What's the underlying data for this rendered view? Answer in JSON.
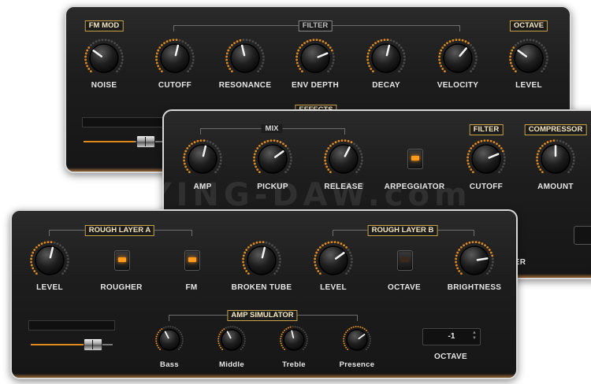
{
  "panel_top": {
    "tags": {
      "fm_mod": "FM MOD",
      "filter": "FILTER",
      "octave": "OCTAVE",
      "effects": "EFFECTS"
    },
    "knobs": [
      {
        "id": "noise",
        "label": "NOISE",
        "level": 0.3
      },
      {
        "id": "cutoff",
        "label": "CUTOFF",
        "level": 0.55
      },
      {
        "id": "resonance",
        "label": "RESONANCE",
        "level": 0.45
      },
      {
        "id": "env_depth",
        "label": "ENV DEPTH",
        "level": 0.75
      },
      {
        "id": "decay",
        "label": "DECAY",
        "level": 0.55
      },
      {
        "id": "velocity",
        "label": "VELOCITY",
        "level": 0.65
      },
      {
        "id": "level",
        "label": "LEVEL",
        "level": 0.3
      }
    ]
  },
  "panel_mid": {
    "tags": {
      "mix": "MIX",
      "filter": "FILTER",
      "compressor": "COMPRESSOR"
    },
    "knobs": [
      {
        "id": "amp",
        "label": "AMP",
        "level": 0.55
      },
      {
        "id": "pickup",
        "label": "PICKUP",
        "level": 0.7
      },
      {
        "id": "release",
        "label": "RELEASE",
        "level": 0.6
      },
      {
        "id": "cutoff",
        "label": "CUTOFF",
        "level": 0.75
      },
      {
        "id": "amount",
        "label": "AMOUNT",
        "level": 0.5
      }
    ],
    "arpeggiator": {
      "label": "ARPEGGIATOR",
      "on": true
    },
    "partial_label": "ER"
  },
  "panel_bottom": {
    "tags": {
      "rough_a": "ROUGH LAYER A",
      "rough_b": "ROUGH LAYER B",
      "amp_sim": "AMP SIMULATOR"
    },
    "controls": {
      "level_a": {
        "label": "LEVEL",
        "level": 0.55
      },
      "rougher": {
        "label": "ROUGHER",
        "on": true
      },
      "fm": {
        "label": "FM",
        "on": true
      },
      "broken_tube": {
        "label": "BROKEN TUBE",
        "level": 0.55
      },
      "level_b": {
        "label": "LEVEL",
        "level": 0.7
      },
      "octave": {
        "label": "OCTAVE",
        "on": false
      },
      "brightness": {
        "label": "BRIGHTNESS",
        "level": 0.8
      }
    },
    "amp_sim_knobs": [
      {
        "id": "bass",
        "label": "Bass",
        "level": 0.4
      },
      {
        "id": "middle",
        "label": "Middle",
        "level": 0.4
      },
      {
        "id": "treble",
        "label": "Treble",
        "level": 0.45
      },
      {
        "id": "presence",
        "label": "Presence",
        "level": 0.7
      }
    ],
    "octave_box": {
      "value": "-1",
      "label": "OCTAVE"
    },
    "slider": {
      "value": 0.65
    }
  },
  "watermark": "FLYING-DAW.com",
  "colors": {
    "accent": "#e08a1e",
    "tag_border": "#c9a348",
    "led_on": "#ff9a1c"
  }
}
